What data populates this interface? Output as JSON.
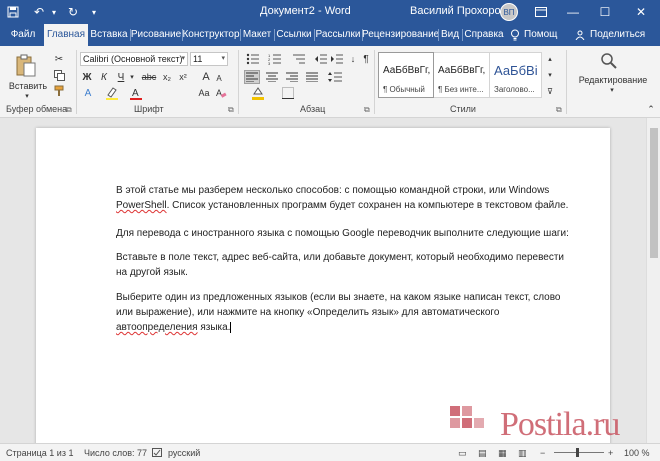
{
  "titlebar": {
    "doc_title": "Документ2  -  Word",
    "user_name": "Василий Прохоров",
    "avatar_initials": "ВП"
  },
  "tabs": [
    "Файл",
    "Главная",
    "Вставка",
    "Рисование",
    "Конструктор",
    "Макет",
    "Ссылки",
    "Рассылки",
    "Рецензирование",
    "Вид",
    "Справка",
    "Помощ",
    "Поделиться"
  ],
  "ribbon": {
    "clipboard": {
      "paste_label": "Вставить",
      "group_label": "Буфер обмена"
    },
    "font": {
      "font_name": "Calibri (Основной текст)",
      "font_size": "11",
      "bold": "Ж",
      "italic": "К",
      "underline": "Ч",
      "strike": "abc",
      "subscript": "x₂",
      "superscript": "x²",
      "grow": "A",
      "shrink": "A",
      "case": "Aa",
      "group_label": "Шрифт"
    },
    "paragraph": {
      "group_label": "Абзац"
    },
    "styles": {
      "items": [
        {
          "sample": "АаБбВвГг,",
          "name": "¶ Обычный"
        },
        {
          "sample": "АаБбВвГг,",
          "name": "¶ Без инте..."
        },
        {
          "sample": "АаБбВі",
          "name": "Заголово..."
        }
      ],
      "group_label": "Стили"
    },
    "editing": {
      "label": "Редактирование"
    }
  },
  "document": {
    "p1_a": "В этой статье мы разберем несколько способов: с помощью командной строки, или Windows",
    "p1_b_squiggle": "PowerShell",
    "p1_b_rest": ". Список установленных программ будет сохранен на компьютере в текстовом файле.",
    "p2": "Для перевода с иностранного языка с помощью Google переводчик выполните следующие шаги:",
    "p3": "Вставьте в поле текст, адрес веб-сайта, или добавьте документ, который необходимо перевести на другой язык.",
    "p4_a": "Выберите один из предложенных языков (если вы знаете, на каком языке написан текст, слово или выражение), или нажмите на кнопку «Определить язык» для автоматического",
    "p4_squiggle": "автоопределения",
    "p4_rest": " языка."
  },
  "statusbar": {
    "page": "Страница 1 из 1",
    "words": "Число слов: 77",
    "language": "русский",
    "zoom": "100 %"
  },
  "watermark": {
    "text": "Postila.ru"
  }
}
